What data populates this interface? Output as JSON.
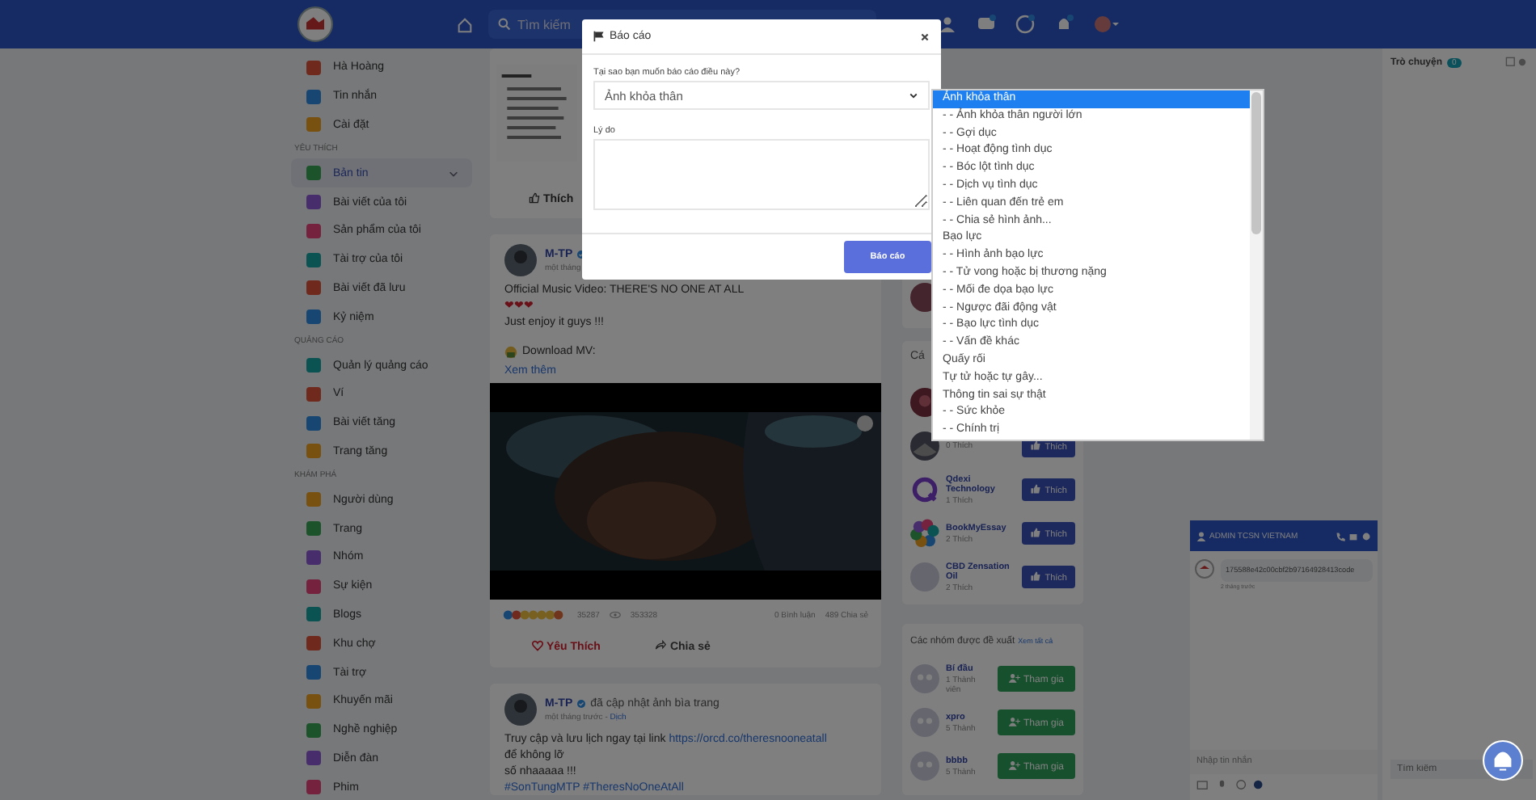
{
  "topbar": {
    "search_placeholder": "Tìm kiếm"
  },
  "sidebar": {
    "sections": [
      {
        "items": [
          {
            "label": "Hà Hoàng",
            "selected": false
          },
          {
            "label": "Tin nhắn",
            "selected": false
          },
          {
            "label": "Cài đặt",
            "selected": false
          }
        ]
      },
      {
        "heading": "YÊU THÍCH",
        "items": [
          {
            "label": "Bản tin",
            "selected": true
          },
          {
            "label": "Bài viết của tôi",
            "selected": false
          },
          {
            "label": "Sản phẩm của tôi",
            "selected": false
          },
          {
            "label": "Tài trợ của tôi",
            "selected": false
          },
          {
            "label": "Bài viết đã lưu",
            "selected": false
          },
          {
            "label": "Kỷ niệm",
            "selected": false
          }
        ]
      },
      {
        "heading": "QUẢNG CÁO",
        "items": [
          {
            "label": "Quản lý quảng cáo",
            "selected": false
          },
          {
            "label": "Ví",
            "selected": false
          },
          {
            "label": "Bài viết tăng",
            "selected": false
          },
          {
            "label": "Trang tăng",
            "selected": false
          }
        ]
      },
      {
        "heading": "KHÁM PHÁ",
        "items": [
          {
            "label": "Người dùng",
            "selected": false
          },
          {
            "label": "Trang",
            "selected": false
          },
          {
            "label": "Nhóm",
            "selected": false
          },
          {
            "label": "Sự kiện",
            "selected": false
          },
          {
            "label": "Blogs",
            "selected": false
          },
          {
            "label": "Khu chợ",
            "selected": false
          },
          {
            "label": "Tài trợ",
            "selected": false
          },
          {
            "label": "Khuyến mãi",
            "selected": false
          },
          {
            "label": "Nghề nghiệp",
            "selected": false
          },
          {
            "label": "Diễn đàn",
            "selected": false
          },
          {
            "label": "Phim",
            "selected": false
          }
        ]
      }
    ]
  },
  "feed": {
    "top_card": {
      "like_button": "Thích"
    },
    "video_post": {
      "author": "M-TP",
      "meta": "một tháng",
      "body": [
        {
          "kind": "text",
          "text": "Official Music Video: THERE'S NO ONE AT ALL"
        },
        {
          "kind": "hearts",
          "text": "❤❤❤"
        },
        {
          "kind": "text",
          "text": "Just enjoy it guys !!!"
        },
        {
          "kind": "download",
          "text": "Download MV:"
        }
      ],
      "more": "Xem thêm",
      "reactions": "35287",
      "views": "353328",
      "comments": "0 Bình luận",
      "shares": "489 Chia sẻ",
      "actions": [
        {
          "kind": "love",
          "label": "Yêu Thích"
        },
        {
          "kind": "share",
          "label": "Chia sẻ"
        }
      ]
    },
    "cover_post": {
      "author": "M-TP",
      "action": "đã cập nhật ảnh bìa trang",
      "time": "một tháng trước -",
      "translate": "Dịch",
      "text": "Truy cập và lưu lịch ngay tại link",
      "link": "https://orcd.co/theresnooneatall",
      "lines": [
        "để không lỡ",
        "số nhaaaaa !!!"
      ],
      "hashtags": "#SonTungMTP #TheresNoOneAtAll"
    }
  },
  "pages_card": {
    "heading": "Cá",
    "pages": [
      {
        "kind": "dark"
      },
      {
        "likes": "0 Thích",
        "button": "Thích"
      },
      {
        "kind": "ring",
        "name": "Qdexi Technology",
        "likes": "1 Thích",
        "button": "Thích"
      },
      {
        "kind": "flower",
        "name": "BookMyEssay",
        "likes": "2 Thích",
        "button": "Thích"
      },
      {
        "kind": "blank",
        "name": "CBD Zensation Oil",
        "likes": "2 Thích",
        "button": "Thích"
      }
    ]
  },
  "groups_card": {
    "heading": "Các nhóm được đề xuất",
    "link": "Xem tất cả",
    "groups": [
      {
        "name": "Bí đầu",
        "members": "1 Thành viên",
        "button": "Tham gia"
      },
      {
        "name": "xpro",
        "members": "5 Thành",
        "button": "Tham gia"
      },
      {
        "name": "bbbb",
        "members": "5 Thành",
        "button": "Tham gia"
      }
    ]
  },
  "chat_window": {
    "title": "ADMIN TCSN VIETNAM",
    "messages": [
      {
        "text": "175588e42c00cbf2b97164928413code",
        "time": "2 tháng trước"
      }
    ],
    "input_placeholder": "Nhập tin nhắn"
  },
  "chat_sidebar": {
    "title": "Trò chuyện",
    "count": "0",
    "search_placeholder": "Tìm kiếm"
  },
  "report_dialog": {
    "title": "Báo cáo",
    "question": "Tại sao bạn muốn báo cáo điều này?",
    "select_value": "Ảnh khỏa thân",
    "reason_label": "Lý do",
    "submit": "Báo cáo",
    "options": [
      {
        "label": "Ảnh khỏa thân",
        "selected": true
      },
      {
        "label": "- - Ảnh khỏa thân người lớn",
        "selected": false
      },
      {
        "label": "- - Gợi dục",
        "selected": false
      },
      {
        "label": "- - Hoạt động tình dục",
        "selected": false
      },
      {
        "label": "- - Bóc lột tình dục",
        "selected": false
      },
      {
        "label": "- - Dịch vụ tình dục",
        "selected": false
      },
      {
        "label": "- - Liên quan đến trẻ em",
        "selected": false
      },
      {
        "label": "- - Chia sẻ hình ảnh...",
        "selected": false
      },
      {
        "label": "Bạo lực",
        "selected": false
      },
      {
        "label": "- - Hình ảnh bạo lực",
        "selected": false
      },
      {
        "label": "- - Tử vong hoặc bị thương nặng",
        "selected": false
      },
      {
        "label": "- - Mối đe dọa bạo lực",
        "selected": false
      },
      {
        "label": "- - Ngược đãi động vật",
        "selected": false
      },
      {
        "label": "- - Bạo lực tình dục",
        "selected": false
      },
      {
        "label": "- - Vấn đề khác",
        "selected": false
      },
      {
        "label": "Quấy rối",
        "selected": false
      },
      {
        "label": "Tự tử hoặc tự gây...",
        "selected": false
      },
      {
        "label": "Thông tin sai sự thật",
        "selected": false
      },
      {
        "label": "- - Sức khỏe",
        "selected": false
      },
      {
        "label": "- - Chính trị",
        "selected": false
      }
    ]
  }
}
